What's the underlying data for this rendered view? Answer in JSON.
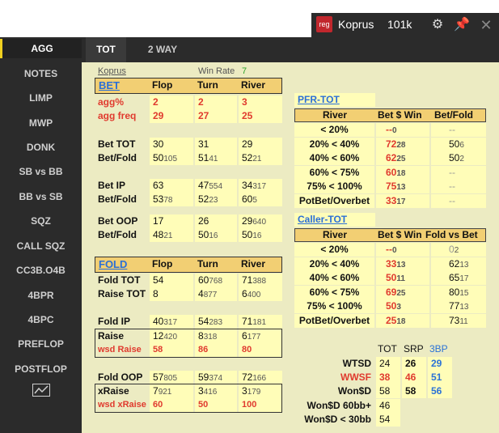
{
  "titlebar": {
    "badge": "reg",
    "player": "Koprus",
    "hands": "101k"
  },
  "sidebar": {
    "items": [
      "AGG",
      "NOTES",
      "LIMP",
      "MWP",
      "DONK",
      "SB vs BB",
      "BB vs SB",
      "SQZ",
      "CALL SQZ",
      "CC3B.O4B",
      "4BPR",
      "4BPC",
      "PREFLOP",
      "POSTFLOP"
    ]
  },
  "tabs": [
    "TOT",
    "2 WAY"
  ],
  "header": {
    "player": "Koprus",
    "winrate_label": "Win Rate",
    "winrate_value": "7"
  },
  "bet": {
    "title": "BET",
    "cols": [
      "Flop",
      "Turn",
      "River"
    ],
    "agg_pct_label": "agg%",
    "agg_pct": [
      "2",
      "2",
      "3"
    ],
    "agg_freq_label": "agg freq",
    "agg_freq": [
      "29",
      "27",
      "25"
    ],
    "bet_tot_label": "Bet TOT",
    "bet_tot": [
      "30",
      "31",
      "29"
    ],
    "bf1_label": "Bet/Fold",
    "bf1": [
      [
        "50",
        "105"
      ],
      [
        "51",
        "41"
      ],
      [
        "52",
        "21"
      ]
    ],
    "bet_ip_label": "Bet IP",
    "bet_ip": [
      [
        "63",
        ""
      ],
      [
        "47",
        "554"
      ],
      [
        "34",
        "317"
      ]
    ],
    "bf2_label": "Bet/Fold",
    "bf2": [
      [
        "53",
        "78"
      ],
      [
        "52",
        "23"
      ],
      [
        "60",
        "5"
      ]
    ],
    "bet_oop_label": "Bet OOP",
    "bet_oop": [
      [
        "17",
        ""
      ],
      [
        "26",
        ""
      ],
      [
        "29",
        "640"
      ]
    ],
    "bf3_label": "Bet/Fold",
    "bf3": [
      [
        "48",
        "21"
      ],
      [
        "50",
        "16"
      ],
      [
        "50",
        "16"
      ]
    ]
  },
  "fold": {
    "title": "FOLD",
    "cols": [
      "Flop",
      "Turn",
      "River"
    ],
    "fold_tot_label": "Fold TOT",
    "fold_tot": [
      [
        "54",
        ""
      ],
      [
        "60",
        "768"
      ],
      [
        "71",
        "388"
      ]
    ],
    "raise_tot_label": "Raise TOT",
    "raise_tot": [
      [
        "8",
        ""
      ],
      [
        "4",
        "877"
      ],
      [
        "6",
        "400"
      ]
    ],
    "fold_ip_label": "Fold IP",
    "fold_ip": [
      [
        "40",
        "317"
      ],
      [
        "54",
        "283"
      ],
      [
        "71",
        "181"
      ]
    ],
    "raise_label": "Raise",
    "raise": [
      [
        "12",
        "420"
      ],
      [
        "8",
        "318"
      ],
      [
        "6",
        "177"
      ]
    ],
    "wsd_raise_label": "wsd Raise",
    "wsd_raise": [
      "58",
      "86",
      "80"
    ],
    "fold_oop_label": "Fold OOP",
    "fold_oop": [
      [
        "57",
        "805"
      ],
      [
        "59",
        "374"
      ],
      [
        "72",
        "166"
      ]
    ],
    "xraise_label": "xRaise",
    "xraise": [
      [
        "7",
        "921"
      ],
      [
        "3",
        "416"
      ],
      [
        "3",
        "179"
      ]
    ],
    "wsd_xraise_label": "wsd xRaise",
    "wsd_xraise": [
      "60",
      "50",
      "100"
    ]
  },
  "pfr_tot": {
    "title": "PFR-TOT",
    "cols": [
      "River",
      "Bet $ Win",
      "Bet/Fold"
    ],
    "rows": [
      {
        "label": "< 20%",
        "win": "--",
        "win_n": "0",
        "bf": "--",
        "bf_n": ""
      },
      {
        "label": "20% < 40%",
        "win": "72",
        "win_n": "28",
        "bf": "50",
        "bf_n": "6"
      },
      {
        "label": "40% < 60%",
        "win": "62",
        "win_n": "25",
        "bf": "50",
        "bf_n": "2"
      },
      {
        "label": "60% < 75%",
        "win": "60",
        "win_n": "18",
        "bf": "--",
        "bf_n": ""
      },
      {
        "label": "75% < 100%",
        "win": "75",
        "win_n": "13",
        "bf": "--",
        "bf_n": ""
      },
      {
        "label": "PotBet/Overbet",
        "win": "33",
        "win_n": "17",
        "bf": "--",
        "bf_n": ""
      }
    ]
  },
  "caller_tot": {
    "title": "Caller-TOT",
    "cols": [
      "River",
      "Bet $ Win",
      "Fold vs Bet"
    ],
    "rows": [
      {
        "label": "< 20%",
        "win": "--",
        "win_n": "0",
        "fv": "0",
        "fv_n": "2"
      },
      {
        "label": "20% < 40%",
        "win": "33",
        "win_n": "13",
        "fv": "62",
        "fv_n": "13"
      },
      {
        "label": "40% < 60%",
        "win": "50",
        "win_n": "11",
        "fv": "65",
        "fv_n": "17"
      },
      {
        "label": "60% < 75%",
        "win": "69",
        "win_n": "25",
        "fv": "80",
        "fv_n": "15"
      },
      {
        "label": "75% < 100%",
        "win": "50",
        "win_n": "3",
        "fv": "77",
        "fv_n": "13"
      },
      {
        "label": "PotBet/Overbet",
        "win": "25",
        "win_n": "18",
        "fv": "73",
        "fv_n": "11"
      }
    ]
  },
  "wtsd": {
    "cols": [
      "TOT",
      "SRP",
      "3BP"
    ],
    "rows": [
      {
        "label": "WTSD",
        "vals": [
          "24",
          "26",
          "29"
        ]
      },
      {
        "label": "WWSF",
        "vals": [
          "38",
          "46",
          "51"
        ]
      },
      {
        "label": "Won$D",
        "vals": [
          "58",
          "58",
          "56"
        ]
      },
      {
        "label": "Won$D 60bb+",
        "vals": [
          "46"
        ]
      },
      {
        "label": "Won$D < 30bb",
        "vals": [
          "54"
        ]
      }
    ]
  },
  "colors": {
    "accent": "#f0d020",
    "panel": "#ecebc2",
    "header": "#f2cf73",
    "value": "#fffdb8",
    "red": "#e03a2e",
    "blue": "#2b73d6"
  }
}
